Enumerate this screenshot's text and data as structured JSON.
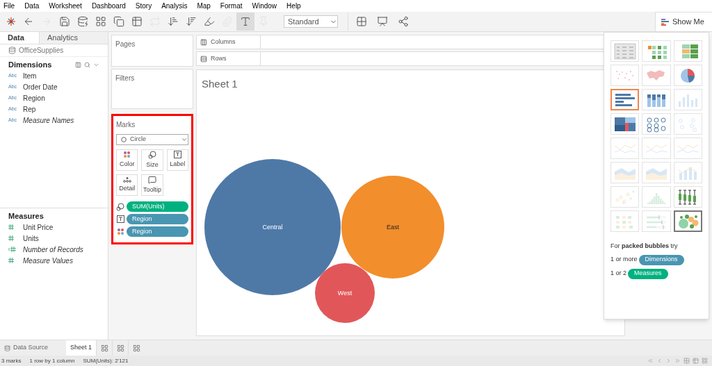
{
  "menu": [
    "File",
    "Data",
    "Worksheet",
    "Dashboard",
    "Story",
    "Analysis",
    "Map",
    "Format",
    "Window",
    "Help"
  ],
  "toolbar": {
    "items": [
      {
        "kind": "logo",
        "disabled": false,
        "pressed": false
      },
      {
        "kind": "back",
        "disabled": false,
        "pressed": false
      },
      {
        "kind": "forward",
        "disabled": true,
        "pressed": false
      },
      {
        "kind": "save",
        "disabled": false,
        "pressed": false
      },
      {
        "kind": "new-datasource",
        "disabled": false,
        "pressed": false
      },
      {
        "kind": "new-worksheet",
        "disabled": false,
        "pressed": false
      },
      {
        "kind": "duplicate",
        "disabled": false,
        "pressed": false
      },
      {
        "kind": "clear",
        "disabled": false,
        "pressed": false
      },
      {
        "kind": "swap",
        "disabled": true,
        "pressed": false
      },
      {
        "kind": "sort-ascending",
        "disabled": false,
        "pressed": false
      },
      {
        "kind": "sort-descending",
        "disabled": false,
        "pressed": false
      },
      {
        "kind": "highlight",
        "disabled": false,
        "pressed": false
      },
      {
        "kind": "group",
        "disabled": true,
        "pressed": false
      },
      {
        "kind": "labels",
        "disabled": false,
        "pressed": true
      },
      {
        "kind": "pin",
        "disabled": true,
        "pressed": false
      }
    ],
    "fit": {
      "value": "Standard"
    },
    "after": [
      {
        "kind": "cards",
        "disabled": false,
        "pressed": false
      },
      {
        "kind": "presentation",
        "disabled": false,
        "pressed": false
      },
      {
        "kind": "share",
        "disabled": false,
        "pressed": false
      }
    ],
    "show_me": {
      "label": "Show Me"
    }
  },
  "data_pane": {
    "tabs": [
      {
        "label": "Data",
        "selected": true
      },
      {
        "label": "Analytics",
        "selected": false
      }
    ],
    "datasource": "OfficeSupplies",
    "dimensions": {
      "title": "Dimensions",
      "fields": [
        {
          "type": "Abc",
          "name": "Item",
          "italic": false
        },
        {
          "type": "Abc",
          "name": "Order Date",
          "italic": false
        },
        {
          "type": "Abc",
          "name": "Region",
          "italic": false
        },
        {
          "type": "Abc",
          "name": "Rep",
          "italic": false
        },
        {
          "type": "Abc",
          "name": "Measure Names",
          "italic": true
        }
      ]
    },
    "measures": {
      "title": "Measures",
      "fields": [
        {
          "kind": "measure",
          "name": "Unit Price",
          "italic": false
        },
        {
          "kind": "measure",
          "name": "Units",
          "italic": false
        },
        {
          "kind": "generated",
          "name": "Number of Records",
          "italic": true
        },
        {
          "kind": "measure",
          "name": "Measure Values",
          "italic": true
        }
      ]
    }
  },
  "shelves": {
    "pages": "Pages",
    "filters": "Filters",
    "columns": "Columns",
    "rows": "Rows"
  },
  "marks": {
    "title": "Marks",
    "highlighted": true,
    "mark_type": "Circle",
    "buttons": [
      {
        "kind": "color",
        "label": "Color"
      },
      {
        "kind": "size",
        "label": "Size"
      },
      {
        "kind": "label",
        "label": "Label"
      },
      {
        "kind": "detail",
        "label": "Detail"
      },
      {
        "kind": "tooltip",
        "label": "Tooltip"
      }
    ],
    "pills": [
      {
        "kind": "size",
        "label": "SUM(Units)",
        "color": "#00b180"
      },
      {
        "kind": "label",
        "label": "Region",
        "color": "#4996b2"
      },
      {
        "kind": "color",
        "label": "Region",
        "color": "#4996b2"
      }
    ]
  },
  "view": {
    "title": "Sheet 1",
    "bubbles": [
      {
        "label": "Central",
        "color": "#4e79a7"
      },
      {
        "label": "East",
        "color": "#f28e2b"
      },
      {
        "label": "West",
        "color": "#e15759"
      }
    ]
  },
  "show_me": {
    "charts": [
      {
        "kind": "text-table",
        "available": true,
        "recommended": false,
        "selected": false
      },
      {
        "kind": "heat-map",
        "available": true,
        "recommended": false,
        "selected": false
      },
      {
        "kind": "highlight-table",
        "available": true,
        "recommended": false,
        "selected": false
      },
      {
        "kind": "symbol-map",
        "available": false,
        "recommended": false,
        "selected": false
      },
      {
        "kind": "filled-map",
        "available": false,
        "recommended": false,
        "selected": false
      },
      {
        "kind": "pie",
        "available": true,
        "recommended": false,
        "selected": false
      },
      {
        "kind": "horizontal-bars",
        "available": true,
        "recommended": true,
        "selected": false
      },
      {
        "kind": "stacked-bars",
        "available": true,
        "recommended": false,
        "selected": false
      },
      {
        "kind": "side-by-side-bars",
        "available": false,
        "recommended": false,
        "selected": false
      },
      {
        "kind": "treemap",
        "available": true,
        "recommended": false,
        "selected": false
      },
      {
        "kind": "circle-view",
        "available": true,
        "recommended": false,
        "selected": false
      },
      {
        "kind": "side-by-side-circles",
        "available": false,
        "recommended": false,
        "selected": false
      },
      {
        "kind": "continuous-lines",
        "available": false,
        "recommended": false,
        "selected": false
      },
      {
        "kind": "discrete-lines",
        "available": false,
        "recommended": false,
        "selected": false
      },
      {
        "kind": "dual-lines",
        "available": false,
        "recommended": false,
        "selected": false
      },
      {
        "kind": "continuous-area",
        "available": false,
        "recommended": false,
        "selected": false
      },
      {
        "kind": "discrete-area",
        "available": false,
        "recommended": false,
        "selected": false
      },
      {
        "kind": "dual-combination",
        "available": false,
        "recommended": false,
        "selected": false
      },
      {
        "kind": "scatter",
        "available": false,
        "recommended": false,
        "selected": false
      },
      {
        "kind": "histogram",
        "available": false,
        "recommended": false,
        "selected": false
      },
      {
        "kind": "box-plot",
        "available": true,
        "recommended": false,
        "selected": false
      },
      {
        "kind": "gantt",
        "available": false,
        "recommended": false,
        "selected": false
      },
      {
        "kind": "bullet",
        "available": false,
        "recommended": false,
        "selected": false
      },
      {
        "kind": "packed-bubbles",
        "available": true,
        "recommended": false,
        "selected": true
      }
    ],
    "hint": "For **packed bubbles** try",
    "requirements": [
      {
        "count": "1 or more",
        "pill": "Dimensions",
        "color": "#4996b2"
      },
      {
        "count": "1 or 2",
        "pill": "Measures",
        "color": "#00b180"
      }
    ]
  },
  "sheet_tabs": [
    {
      "kind": "data-source",
      "label": "Data Source",
      "selected": false
    },
    {
      "kind": "sheet",
      "label": "Sheet 1",
      "selected": true
    }
  ],
  "status": [
    "3 marks",
    "1 row by 1 column",
    "SUM(Units): 2'121"
  ]
}
